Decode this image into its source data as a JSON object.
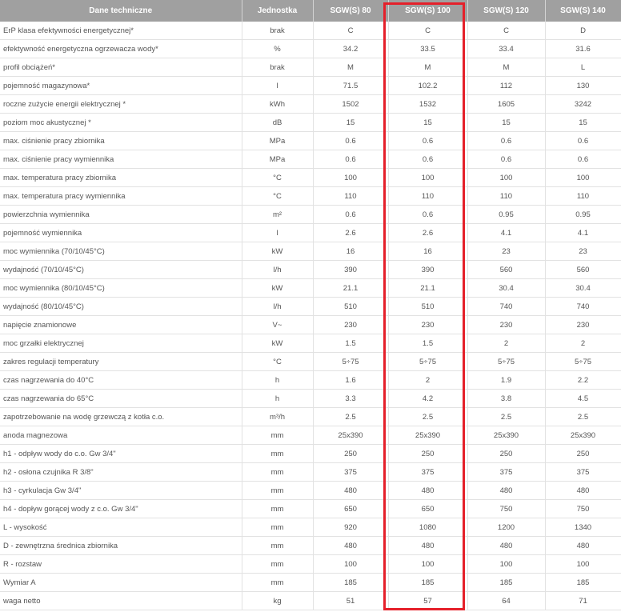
{
  "headers": [
    "Dane techniczne",
    "Jednostka",
    "SGW(S) 80",
    "SGW(S) 100",
    "SGW(S) 120",
    "SGW(S) 140"
  ],
  "rows": [
    [
      "ErP klasa efektywności energetycznej*",
      "brak",
      "C",
      "C",
      "C",
      "D"
    ],
    [
      "efektywność energetyczna ogrzewacza wody*",
      "%",
      "34.2",
      "33.5",
      "33.4",
      "31.6"
    ],
    [
      "profil obciążeń*",
      "brak",
      "M",
      "M",
      "M",
      "L"
    ],
    [
      "pojemność magazynowa*",
      "l",
      "71.5",
      "102.2",
      "112",
      "130"
    ],
    [
      "roczne zużycie energii elektrycznej *",
      "kWh",
      "1502",
      "1532",
      "1605",
      "3242"
    ],
    [
      "poziom moc akustycznej *",
      "dB",
      "15",
      "15",
      "15",
      "15"
    ],
    [
      "max. ciśnienie pracy zbiornika",
      "MPa",
      "0.6",
      "0.6",
      "0.6",
      "0.6"
    ],
    [
      "max. ciśnienie pracy wymiennika",
      "MPa",
      "0.6",
      "0.6",
      "0.6",
      "0.6"
    ],
    [
      "max. temperatura pracy zbiornika",
      "°C",
      "100",
      "100",
      "100",
      "100"
    ],
    [
      "max. temperatura pracy wymiennika",
      "°C",
      "110",
      "110",
      "110",
      "110"
    ],
    [
      "powierzchnia wymiennika",
      "m²",
      "0.6",
      "0.6",
      "0.95",
      "0.95"
    ],
    [
      "pojemność wymiennika",
      "l",
      "2.6",
      "2.6",
      "4.1",
      "4.1"
    ],
    [
      "moc wymiennika (70/10/45°C)",
      "kW",
      "16",
      "16",
      "23",
      "23"
    ],
    [
      "wydajność (70/10/45°C)",
      "l/h",
      "390",
      "390",
      "560",
      "560"
    ],
    [
      "moc wymiennika (80/10/45°C)",
      "kW",
      "21.1",
      "21.1",
      "30.4",
      "30.4"
    ],
    [
      "wydajność (80/10/45°C)",
      "l/h",
      "510",
      "510",
      "740",
      "740"
    ],
    [
      "napięcie znamionowe",
      "V~",
      "230",
      "230",
      "230",
      "230"
    ],
    [
      "moc grzałki elektrycznej",
      "kW",
      "1.5",
      "1.5",
      "2",
      "2"
    ],
    [
      "zakres regulacji temperatury",
      "°C",
      "5÷75",
      "5÷75",
      "5÷75",
      "5÷75"
    ],
    [
      "czas nagrzewania do 40°C",
      "h",
      "1.6",
      "2",
      "1.9",
      "2.2"
    ],
    [
      "czas nagrzewania do 65°C",
      "h",
      "3.3",
      "4.2",
      "3.8",
      "4.5"
    ],
    [
      "zapotrzebowanie na wodę grzewczą z kotła c.o.",
      "m³/h",
      "2.5",
      "2.5",
      "2.5",
      "2.5"
    ],
    [
      "anoda magnezowa",
      "mm",
      "25x390",
      "25x390",
      "25x390",
      "25x390"
    ],
    [
      "h1 - odpływ wody do c.o. Gw 3/4\"",
      "mm",
      "250",
      "250",
      "250",
      "250"
    ],
    [
      "h2 - osłona czujnika R 3/8\"",
      "mm",
      "375",
      "375",
      "375",
      "375"
    ],
    [
      "h3 - cyrkulacja Gw 3/4\"",
      "mm",
      "480",
      "480",
      "480",
      "480"
    ],
    [
      "h4 - dopływ gorącej wody z c.o. Gw 3/4\"",
      "mm",
      "650",
      "650",
      "750",
      "750"
    ],
    [
      "L - wysokość",
      "mm",
      "920",
      "1080",
      "1200",
      "1340"
    ],
    [
      "D - zewnętrzna średnica zbiornika",
      "mm",
      "480",
      "480",
      "480",
      "480"
    ],
    [
      "R - rozstaw",
      "mm",
      "100",
      "100",
      "100",
      "100"
    ],
    [
      "Wymiar A",
      "mm",
      "185",
      "185",
      "185",
      "185"
    ],
    [
      "waga netto",
      "kg",
      "51",
      "57",
      "64",
      "71"
    ]
  ],
  "highlight": {
    "column": "SGW(S) 100",
    "color": "#e5202a"
  }
}
